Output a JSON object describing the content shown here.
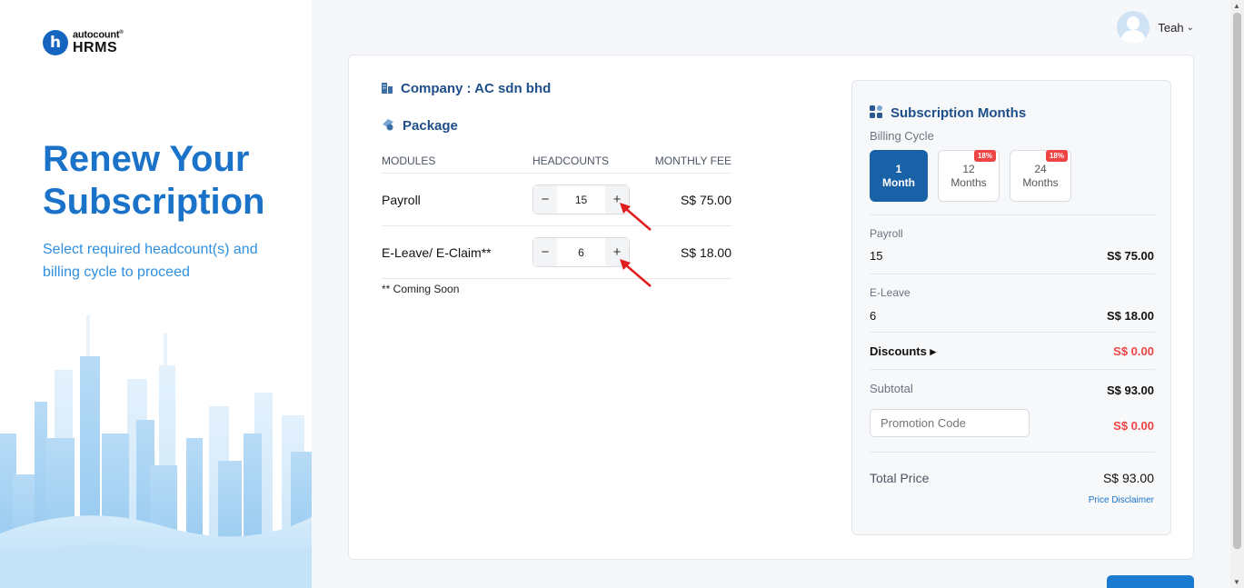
{
  "brand": {
    "logo_letter": "h",
    "logo_top": "autocount",
    "logo_reg": "®",
    "logo_bottom": "HRMS"
  },
  "hero": {
    "title_line1": "Renew Your",
    "title_line2": "Subscription",
    "subtitle": "Select required headcount(s) and billing cycle to proceed"
  },
  "user": {
    "name": "Teah",
    "chevron": "⌄"
  },
  "company": {
    "label": "Company : AC sdn bhd",
    "icon": "building-icon"
  },
  "package": {
    "label": "Package",
    "icon": "package-icon",
    "columns": [
      "MODULES",
      "HEADCOUNTS",
      "MONTHLY FEE"
    ],
    "rows": [
      {
        "module": "Payroll",
        "headcount": "15",
        "fee": "S$ 75.00"
      },
      {
        "module": "E-Leave/ E-Claim**",
        "headcount": "6",
        "fee": "S$ 18.00"
      }
    ],
    "minus": "−",
    "plus": "+",
    "note": "** Coming Soon"
  },
  "summary": {
    "title": "Subscription Months",
    "billing_label": "Billing Cycle",
    "cycles": [
      {
        "num": "1",
        "unit": "Month",
        "badge": ""
      },
      {
        "num": "12",
        "unit": "Months",
        "badge": "18%"
      },
      {
        "num": "24",
        "unit": "Months",
        "badge": "18%"
      }
    ],
    "payroll_label": "Payroll",
    "payroll_count": "15",
    "payroll_fee": "S$ 75.00",
    "eleave_label": "E-Leave",
    "eleave_count": "6",
    "eleave_fee": "S$ 18.00",
    "discounts_label": "Discounts ▸",
    "discounts_value": "S$ 0.00",
    "subtotal_label": "Subtotal",
    "subtotal_value": "S$ 93.00",
    "promo_placeholder": "Promotion Code",
    "promo_value": "S$ 0.00",
    "total_label": "Total Price",
    "total_value": "S$ 93.00",
    "disclaimer": "Price Disclaimer"
  },
  "colors": {
    "primary": "#1a62a8",
    "accent": "#1a73c8",
    "danger": "#ef4444"
  }
}
